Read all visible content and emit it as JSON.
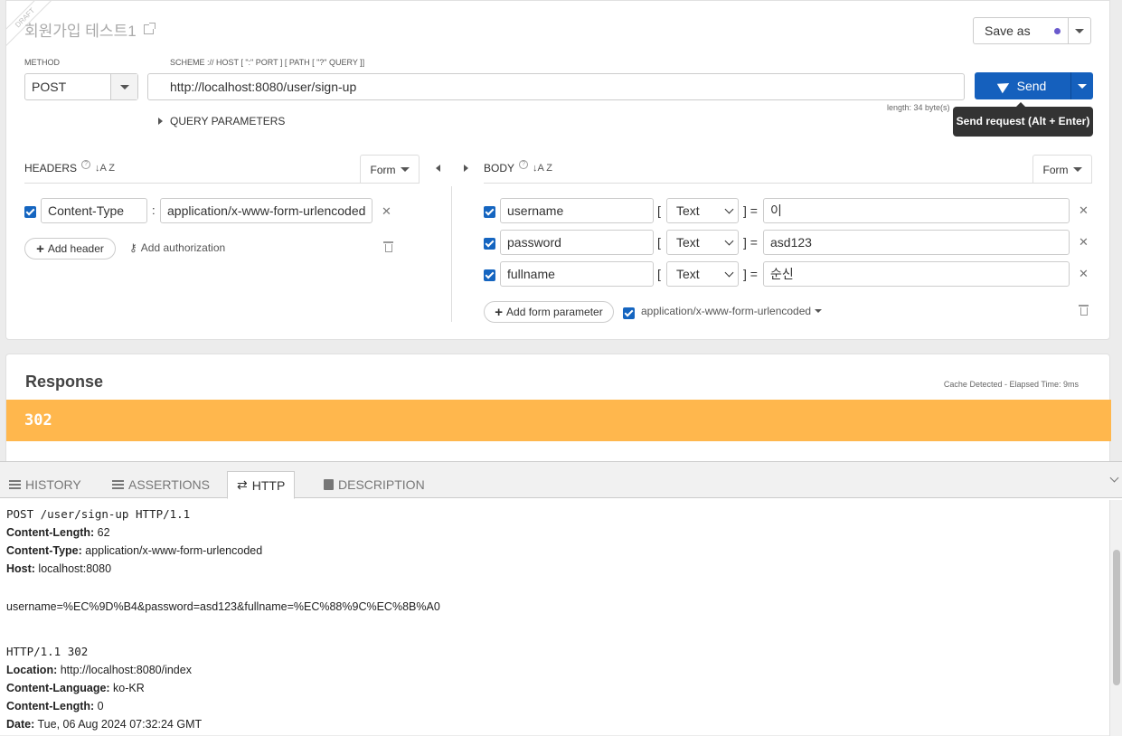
{
  "request": {
    "draft_label": "DRAFT",
    "title": "회원가입 테스트1",
    "save_as_label": "Save as",
    "method_label": "METHOD",
    "method_value": "POST",
    "url_label": "SCHEME :// HOST [ \":\" PORT ] [ PATH [ \"?\" QUERY ]]",
    "url_value": "http://localhost:8080/user/sign-up",
    "send_label": "Send",
    "length_text": "length: 34 byte(s)",
    "tooltip": "Send request (Alt + Enter)",
    "query_params_label": "QUERY PARAMETERS"
  },
  "headers": {
    "label": "HEADERS",
    "help": "?",
    "sort": "↓A Z",
    "form_label": "Form",
    "rows": [
      {
        "checked": true,
        "name": "Content-Type",
        "value": "application/x-www-form-urlencoded"
      }
    ],
    "add_header_label": "Add header",
    "add_auth_label": "Add authorization"
  },
  "body": {
    "label": "BODY",
    "help": "?",
    "sort": "↓A Z",
    "form_label": "Form",
    "rows": [
      {
        "checked": true,
        "name": "username",
        "type": "Text",
        "value": "이"
      },
      {
        "checked": true,
        "name": "password",
        "type": "Text",
        "value": "asd123"
      },
      {
        "checked": true,
        "name": "fullname",
        "type": "Text",
        "value": "순신"
      }
    ],
    "open_bracket": "[",
    "close_eq": "] =",
    "add_param_label": "Add form parameter",
    "content_type": "application/x-www-form-urlencoded"
  },
  "response": {
    "title": "Response",
    "meta": "Cache Detected - Elapsed Time: 9ms",
    "status": "302"
  },
  "bottom_tabs": [
    {
      "label": "HISTORY",
      "active": false
    },
    {
      "label": "ASSERTIONS",
      "active": false
    },
    {
      "label": "HTTP",
      "active": true
    },
    {
      "label": "DESCRIPTION",
      "active": false
    }
  ],
  "http": {
    "req_line": "POST /user/sign-up HTTP/1.1",
    "req_headers": [
      {
        "k": "Content-Length:",
        "v": " 62"
      },
      {
        "k": "Content-Type:",
        "v": " application/x-www-form-urlencoded"
      },
      {
        "k": "Host:",
        "v": " localhost:8080"
      }
    ],
    "req_body": "username=%EC%9D%B4&password=asd123&fullname=%EC%88%9C%EC%8B%A0",
    "resp_line": "HTTP/1.1 302",
    "resp_headers": [
      {
        "k": "Location:",
        "v": " http://localhost:8080/index"
      },
      {
        "k": "Content-Language:",
        "v": " ko-KR"
      },
      {
        "k": "Content-Length:",
        "v": " 0"
      },
      {
        "k": "Date:",
        "v": " Tue, 06 Aug 2024 07:32:24 GMT"
      }
    ]
  }
}
